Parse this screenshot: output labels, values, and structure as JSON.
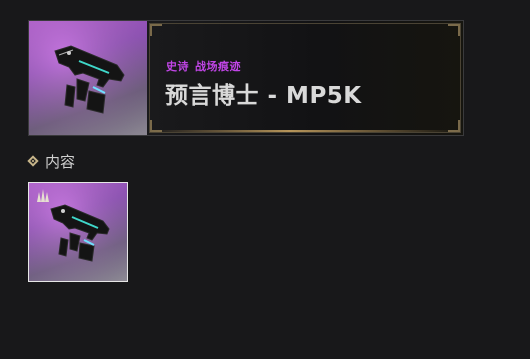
{
  "item": {
    "rarity": "史诗",
    "category": "战场痕迹",
    "title": "预言博士 - MP5K"
  },
  "contents": {
    "heading": "内容",
    "items": [
      {
        "icon": "smg-icon"
      }
    ]
  },
  "colors": {
    "background": "#18181a",
    "epic_purple": "#c045e6",
    "gold_accent": "#c7b58a",
    "title_text": "#d9d9d9"
  }
}
